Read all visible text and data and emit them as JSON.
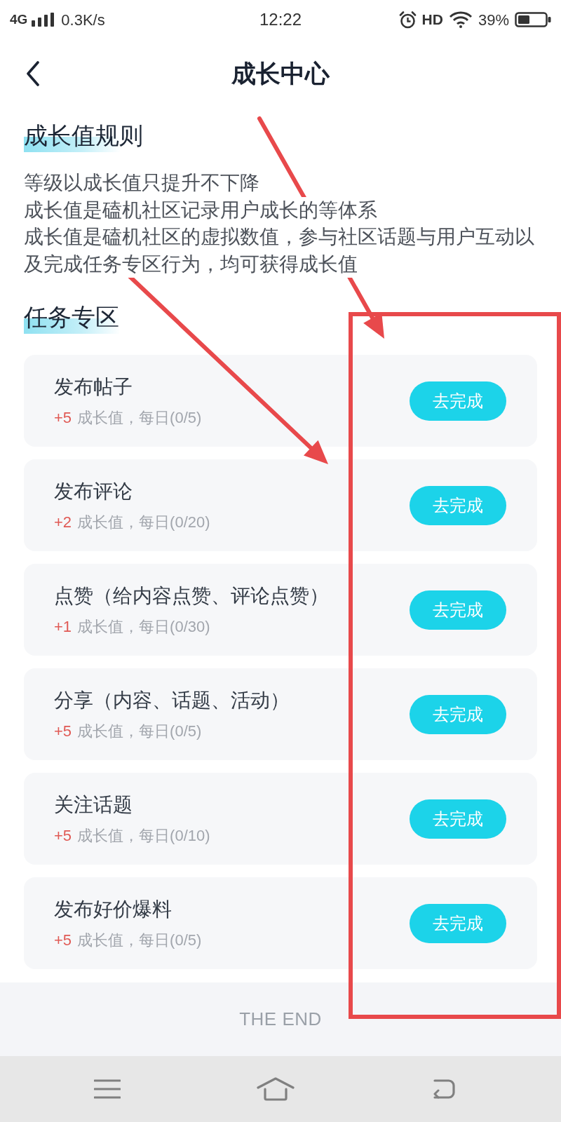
{
  "status_bar": {
    "network": "4G",
    "speed": "0.3K/s",
    "time": "12:22",
    "hd": "HD",
    "battery": "39%"
  },
  "header": {
    "title": "成长中心"
  },
  "rules": {
    "heading": "成长值规则",
    "lines": [
      "等级以成长值只提升不下降",
      "成长值是磕机社区记录用户成长的等体系",
      "成长值是磕机社区的虚拟数值，参与社区话题与用户互动以及完成任务专区行为，均可获得成长值"
    ]
  },
  "tasks": {
    "heading": "任务专区",
    "items": [
      {
        "title": "发布帖子",
        "points": "+5",
        "detail": "成长值，每日(0/5)",
        "button": "去完成"
      },
      {
        "title": "发布评论",
        "points": "+2",
        "detail": "成长值，每日(0/20)",
        "button": "去完成"
      },
      {
        "title": "点赞（给内容点赞、评论点赞）",
        "points": "+1",
        "detail": "成长值，每日(0/30)",
        "button": "去完成"
      },
      {
        "title": "分享（内容、话题、活动）",
        "points": "+5",
        "detail": "成长值，每日(0/5)",
        "button": "去完成"
      },
      {
        "title": "关注话题",
        "points": "+5",
        "detail": "成长值，每日(0/10)",
        "button": "去完成"
      },
      {
        "title": "发布好价爆料",
        "points": "+5",
        "detail": "成长值，每日(0/5)",
        "button": "去完成"
      }
    ]
  },
  "footer": {
    "text": "THE END"
  },
  "annotations": [
    {
      "kind": "arrow"
    },
    {
      "kind": "arrow"
    },
    {
      "kind": "frame"
    }
  ]
}
